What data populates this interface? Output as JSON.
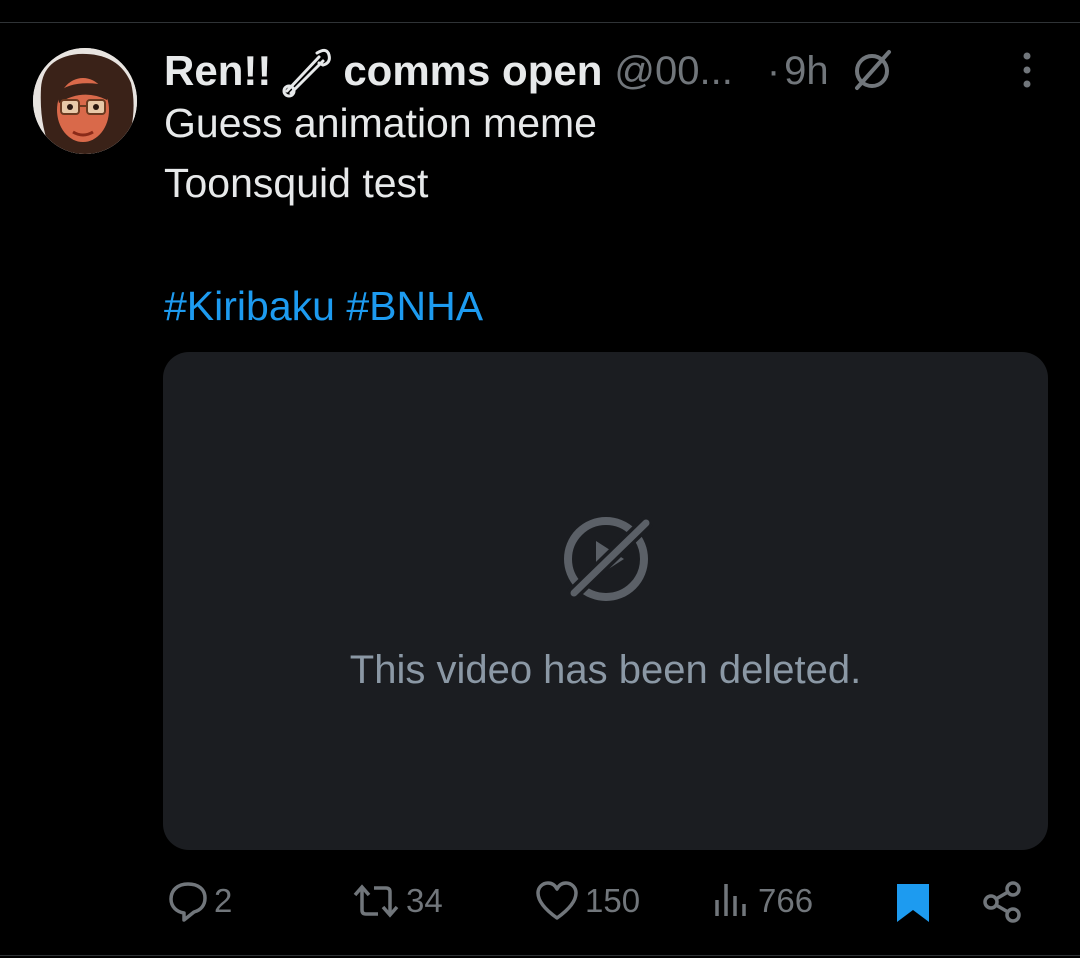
{
  "tweet": {
    "display_name": "Ren!!",
    "name_suffix": "comms open",
    "handle": "@00...",
    "separator": "·",
    "time": "9h",
    "lines": [
      "Guess animation meme",
      "Toonsquid test"
    ],
    "hashtags": [
      "#Kiribaku",
      "#BNHA"
    ]
  },
  "media": {
    "message": "This video has been deleted."
  },
  "actions": {
    "replies": "2",
    "retweets": "34",
    "likes": "150",
    "views": "766"
  },
  "colors": {
    "background": "#000000",
    "text": "#e7e9ea",
    "muted": "#71767b",
    "accent": "#1d9bf0",
    "media_bg": "#1b1d21"
  }
}
